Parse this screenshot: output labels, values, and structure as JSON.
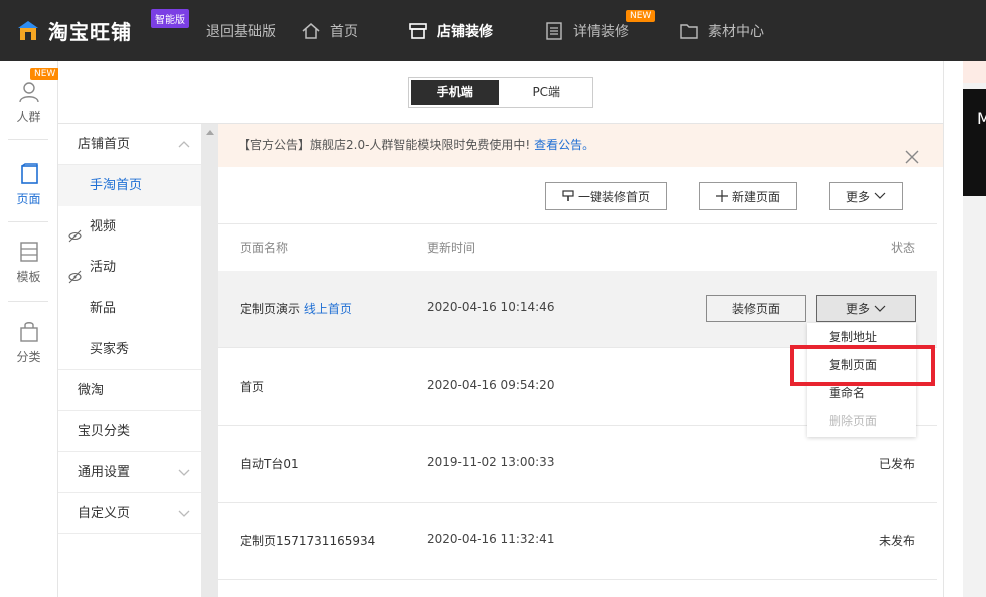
{
  "header": {
    "app_title": "淘宝旺铺",
    "edition_badge": "智能版",
    "nav": [
      {
        "label": "退回基础版",
        "icon": "none"
      },
      {
        "label": "首页",
        "icon": "home-icon"
      },
      {
        "label": "店铺装修",
        "icon": "store-icon",
        "active": true
      },
      {
        "label": "详情装修",
        "icon": "document-icon",
        "tag": "NEW"
      },
      {
        "label": "素材中心",
        "icon": "folder-icon"
      }
    ]
  },
  "rail": {
    "items": [
      {
        "label": "人群",
        "icon": "user-icon",
        "tag": "NEW"
      },
      {
        "label": "页面",
        "icon": "page-icon",
        "active": true
      },
      {
        "label": "模板",
        "icon": "template-icon"
      },
      {
        "label": "分类",
        "icon": "bag-icon"
      }
    ]
  },
  "sidebar": {
    "items": [
      {
        "label": "店铺首页",
        "expanded": true
      },
      {
        "label": "手淘首页",
        "sub": true,
        "active": true
      },
      {
        "label": "视频",
        "sub": true,
        "hidden": true
      },
      {
        "label": "活动",
        "sub": true,
        "hidden": true
      },
      {
        "label": "新品",
        "sub": true
      },
      {
        "label": "买家秀",
        "sub": true
      },
      {
        "label": "微淘"
      },
      {
        "label": "宝贝分类"
      },
      {
        "label": "通用设置",
        "collapsible": true
      },
      {
        "label": "自定义页",
        "collapsible": true
      }
    ]
  },
  "device_toggle": {
    "mobile": "手机端",
    "pc": "PC端",
    "selected": "mobile"
  },
  "notice": {
    "text": "【官方公告】旗舰店2.0-人群智能模块限时免费使用中!",
    "link": "查看公告。"
  },
  "toolbar": {
    "one_click": "一键装修首页",
    "new_page": "新建页面",
    "more": "更多"
  },
  "table": {
    "headers": {
      "name": "页面名称",
      "time": "更新时间",
      "status": "状态"
    },
    "rows": [
      {
        "name": "定制页演示",
        "tag": "线上首页",
        "time": "2020-04-16 10:14:46",
        "status": "",
        "decorate": "装修页面",
        "more": "更多"
      },
      {
        "name": "首页",
        "time": "2020-04-16 09:54:20",
        "status": ""
      },
      {
        "name": "自动T台01",
        "time": "2019-11-02 13:00:33",
        "status": "已发布"
      },
      {
        "name": "定制页1571731165934",
        "time": "2020-04-16 11:32:41",
        "status": "未发布"
      }
    ]
  },
  "dropdown": {
    "items": [
      {
        "label": "复制地址"
      },
      {
        "label": "复制页面",
        "highlighted": true
      },
      {
        "label": "重命名"
      },
      {
        "label": "删除页面",
        "disabled": true
      }
    ]
  },
  "peek": {
    "text": "M"
  },
  "colors": {
    "topbar": "#2b2b2b",
    "accent": "#1f6fd4",
    "badge": "#7b3fe4",
    "new_tag": "#ff8a00",
    "highlight": "#e8242f"
  }
}
